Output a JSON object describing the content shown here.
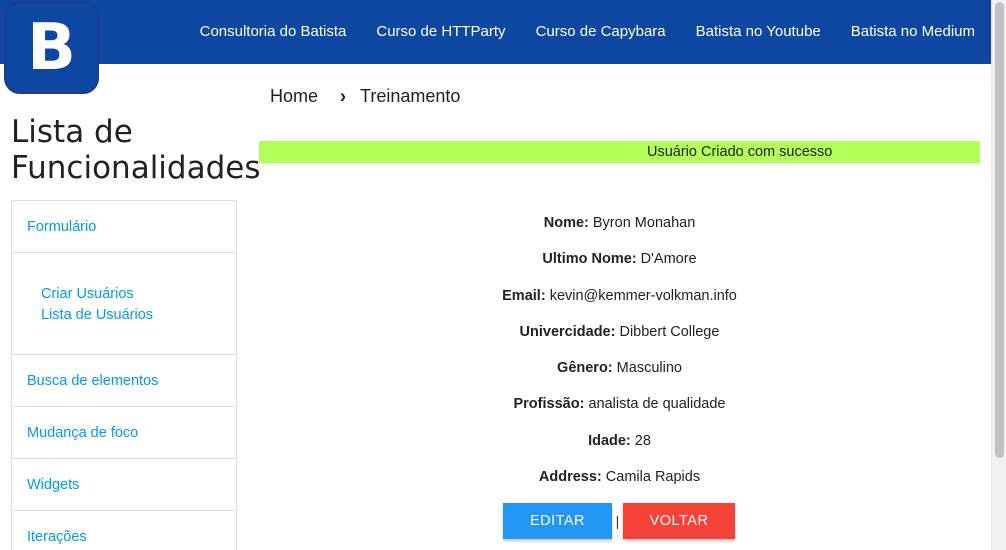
{
  "logo": {
    "letter": "B"
  },
  "nav": {
    "links": [
      "Consultoria do Batista",
      "Curso de HTTParty",
      "Curso de Capybara",
      "Batista no Youtube",
      "Batista no Medium"
    ]
  },
  "sidebar": {
    "title": "Lista de Funcionalidades",
    "items": {
      "formulario": "Formulário",
      "criar_usuarios": "Criar Usuários",
      "lista_usuarios": "Lista de Usuários",
      "busca": "Busca de elementos",
      "mudanca": "Mudança de foco",
      "widgets": "Widgets",
      "iteracoes": "Iterações"
    }
  },
  "breadcrumb": {
    "home": "Home",
    "separator": "›",
    "current": "Treinamento"
  },
  "banner": {
    "text": "Usuário Criado com sucesso",
    "color": "#b2ff59"
  },
  "details": [
    {
      "label": "Nome:",
      "value": "Byron Monahan"
    },
    {
      "label": "Ultimo Nome:",
      "value": "D'Amore"
    },
    {
      "label": "Email:",
      "value": "kevin@kemmer-volkman.info"
    },
    {
      "label": "Univercidade:",
      "value": "Dibbert College"
    },
    {
      "label": "Gênero:",
      "value": "Masculino"
    },
    {
      "label": "Profissão:",
      "value": "analista de qualidade"
    },
    {
      "label": "Idade:",
      "value": "28"
    },
    {
      "label": "Address:",
      "value": "Camila Rapids"
    }
  ],
  "actions": {
    "edit": "EDITAR",
    "separator": "|",
    "back": "VOLTAR"
  },
  "colors": {
    "nav": "#0d47a1",
    "link": "#039be5",
    "edit": "#2196f3",
    "back": "#f44336"
  }
}
